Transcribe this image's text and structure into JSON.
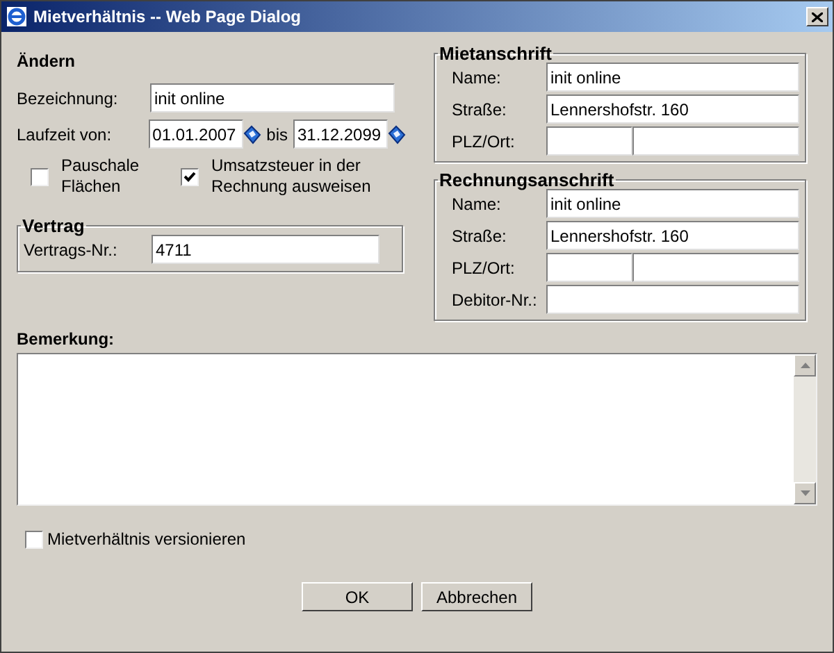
{
  "window": {
    "title": "Mietverhältnis -- Web Page Dialog"
  },
  "aendern": {
    "heading": "Ändern",
    "bezeichnung": {
      "label": "Bezeichnung:",
      "value": "init online"
    },
    "laufzeit": {
      "label": "Laufzeit von:",
      "from": "01.01.2007",
      "separator": "bis",
      "to": "31.12.2099"
    },
    "checkboxes": [
      {
        "label": "Pauschale Flächen",
        "checked": false
      },
      {
        "label": "Umsatzsteuer in der Rechnung ausweisen",
        "checked": true
      }
    ]
  },
  "vertrag": {
    "legend": "Vertrag",
    "label": "Vertrags-Nr.:",
    "value": "4711"
  },
  "addresses": [
    {
      "legend": "Mietanschrift",
      "rows": [
        {
          "kind": "text",
          "label": "Name:",
          "value": "init online"
        },
        {
          "kind": "text",
          "label": "Straße:",
          "value": "Lennershofstr. 160"
        },
        {
          "kind": "split",
          "label": "PLZ/Ort:"
        }
      ]
    },
    {
      "legend": "Rechnungsanschrift",
      "rows": [
        {
          "kind": "text",
          "label": "Name:",
          "value": "init online"
        },
        {
          "kind": "text",
          "label": "Straße:",
          "value": "Lennershofstr. 160"
        },
        {
          "kind": "split",
          "label": "PLZ/Ort:"
        },
        {
          "kind": "text",
          "label": "Debitor-Nr.:"
        }
      ]
    }
  ],
  "bemerkung": {
    "label": "Bemerkung:"
  },
  "versionieren": {
    "label": "Mietverhältnis versionieren",
    "checked": false
  },
  "buttons": [
    "OK",
    "Abbrechen"
  ]
}
